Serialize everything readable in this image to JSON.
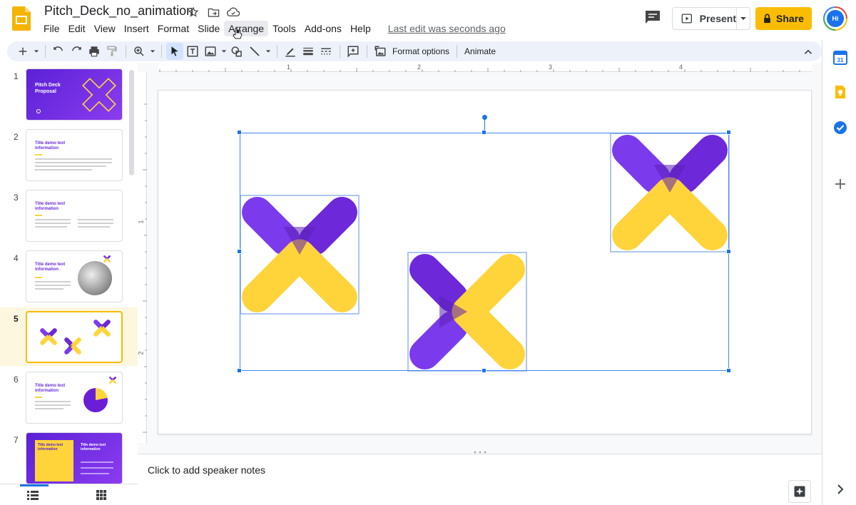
{
  "header": {
    "doc_title": "Pitch_Deck_no_animation",
    "menu": [
      "File",
      "Edit",
      "View",
      "Insert",
      "Format",
      "Slide",
      "Arrange",
      "Tools",
      "Add-ons",
      "Help"
    ],
    "active_menu": "Arrange",
    "last_edit": "Last edit was seconds ago",
    "present_label": "Present",
    "share_label": "Share",
    "avatar_initials": "Hi"
  },
  "toolbar": {
    "format_options": "Format options",
    "animate": "Animate"
  },
  "filmstrip": {
    "slides": [
      {
        "number": "1",
        "title": "Pitch Deck Proposal"
      },
      {
        "number": "2",
        "title": "Title demo text information"
      },
      {
        "number": "3",
        "title": "Title demo text information"
      },
      {
        "number": "4",
        "title": "Title demo text information"
      },
      {
        "number": "5",
        "title": ""
      },
      {
        "number": "6",
        "title": "Title demo text information"
      },
      {
        "number": "7",
        "title": "Title demo text information"
      }
    ],
    "active_slide": "5"
  },
  "ruler": {
    "horizontal": [
      "1",
      "2",
      "3",
      "4"
    ],
    "vertical": [
      "1",
      "2"
    ]
  },
  "notes": {
    "placeholder": "Click to add speaker notes"
  },
  "colors": {
    "purple": "#7c3aed",
    "yellow": "#ffd43b",
    "selection": "#1a73e8",
    "share": "#fbbc04"
  }
}
